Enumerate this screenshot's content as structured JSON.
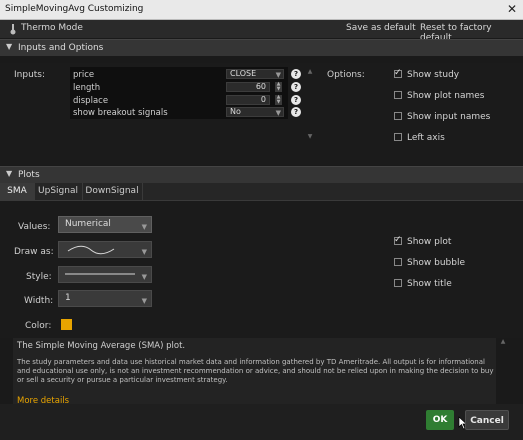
{
  "window": {
    "title": "SimpleMovingAvg Customizing",
    "close": "✕"
  },
  "toolbar": {
    "thermo_mode": "Thermo Mode",
    "save_default": "Save as default",
    "reset_factory": "Reset to factory default"
  },
  "sections": {
    "inputs": "Inputs and Options",
    "plots": "Plots"
  },
  "inputs": {
    "label": "Inputs:",
    "rows": [
      {
        "name": "price",
        "value": "CLOSE"
      },
      {
        "name": "length",
        "value": "60"
      },
      {
        "name": "displace",
        "value": "0"
      },
      {
        "name": "show breakout signals",
        "value": "No"
      }
    ]
  },
  "options": {
    "label": "Options:",
    "items": [
      {
        "label": "Show study",
        "checked": true
      },
      {
        "label": "Show plot names",
        "checked": false
      },
      {
        "label": "Show input names",
        "checked": false
      },
      {
        "label": "Left axis",
        "checked": false
      }
    ]
  },
  "plot_tabs": [
    "SMA",
    "UpSignal",
    "DownSignal"
  ],
  "plot": {
    "values_label": "Values:",
    "values": "Numerical",
    "draw_as_label": "Draw as:",
    "style_label": "Style:",
    "width_label": "Width:",
    "width": "1",
    "color_label": "Color:",
    "color": "#e8a400",
    "checks": [
      {
        "label": "Show plot",
        "checked": true
      },
      {
        "label": "Show bubble",
        "checked": false
      },
      {
        "label": "Show title",
        "checked": false
      }
    ]
  },
  "description": {
    "title": "The Simple Moving Average (SMA) plot.",
    "body": "The study parameters and data use historical market data and information gathered by TD Ameritrade. All output is for informational and educational use only, is not an investment recommendation or advice, and should not be relied upon in making the decision to buy or sell a security or pursue a particular investment strategy.",
    "more": "More details"
  },
  "buttons": {
    "ok": "OK",
    "cancel": "Cancel"
  }
}
